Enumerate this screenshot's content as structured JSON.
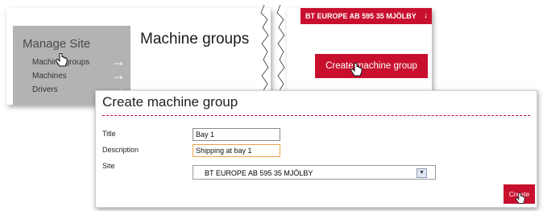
{
  "sidebar": {
    "title": "Manage Site",
    "items": [
      {
        "label": "Machine groups"
      },
      {
        "label": "Machines"
      },
      {
        "label": "Drivers"
      }
    ]
  },
  "main": {
    "title": "Machine groups"
  },
  "header": {
    "site_badge": "BT EUROPE AB 595 35 MJÖLBY"
  },
  "toolbar": {
    "create_group_label": "Create machine group"
  },
  "dialog": {
    "title": "Create machine group",
    "fields": {
      "title_label": "Title",
      "title_value": "Bay 1",
      "description_label": "Description",
      "description_value": "Shipping at bay 1",
      "site_label": "Site",
      "site_value": "BT EUROPE AB 595 35 MJÖLBY"
    },
    "create_label": "Create"
  },
  "colors": {
    "accent": "#c8102e",
    "nav_bg": "#b3b3b3",
    "arrow": "#ffffff"
  },
  "icons": [
    "arrow-right-icon",
    "chevron-down-icon",
    "hand-cursor-icon",
    "dropdown-arrow-icon"
  ]
}
